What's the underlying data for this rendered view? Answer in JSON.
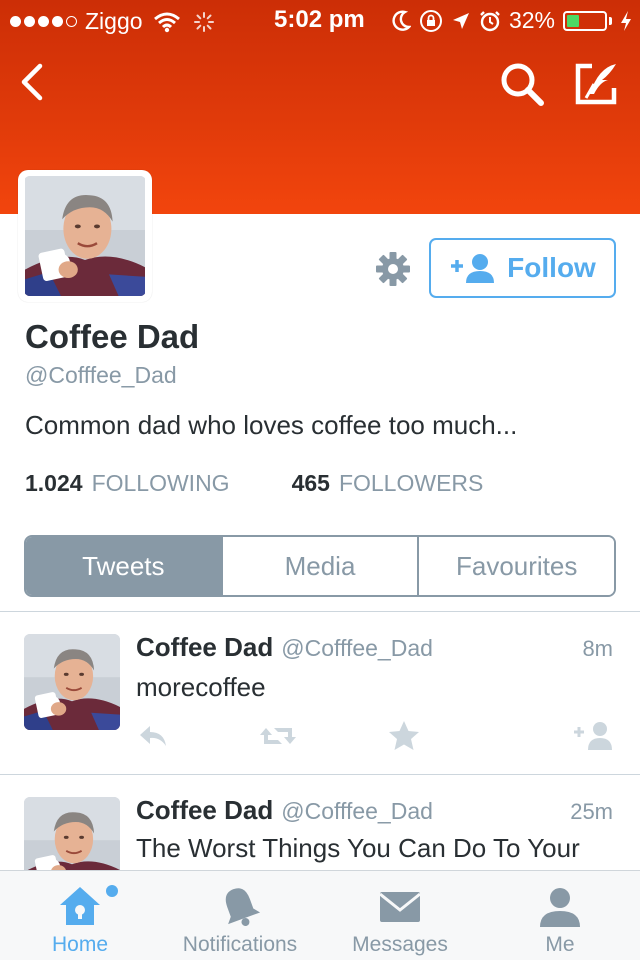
{
  "status_bar": {
    "carrier": "Ziggo",
    "time": "5:02 pm",
    "battery_percent": "32%",
    "battery_level": 0.32,
    "battery_color": "#4cd964"
  },
  "nav": {
    "back_icon": "chevron-left-icon",
    "search_icon": "search-icon",
    "compose_icon": "compose-tweet-icon"
  },
  "profile": {
    "name": "Coffee Dad",
    "handle": "@Cofffee_Dad",
    "bio": "Common dad who loves coffee too much...",
    "following_count": "1.024",
    "following_label": "FOLLOWING",
    "followers_count": "465",
    "followers_label": "FOLLOWERS",
    "follow_label": "Follow"
  },
  "colors": {
    "header": "#e03a0a",
    "accent": "#55acee",
    "muted": "#8899a6",
    "text": "#292f33"
  },
  "tabs": [
    {
      "label": "Tweets",
      "active": true
    },
    {
      "label": "Media",
      "active": false
    },
    {
      "label": "Favourites",
      "active": false
    }
  ],
  "tweets": [
    {
      "name": "Coffee Dad",
      "handle": "@Cofffee_Dad",
      "time": "8m",
      "text": "morecoffee"
    },
    {
      "name": "Coffee Dad",
      "handle": "@Cofffee_Dad",
      "time": "25m",
      "text": "The Worst Things You Can Do To Your"
    }
  ],
  "tabbar": [
    {
      "label": "Home",
      "icon": "home-icon",
      "active": true
    },
    {
      "label": "Notifications",
      "icon": "bell-icon",
      "active": false
    },
    {
      "label": "Messages",
      "icon": "envelope-icon",
      "active": false
    },
    {
      "label": "Me",
      "icon": "person-icon",
      "active": false
    }
  ]
}
